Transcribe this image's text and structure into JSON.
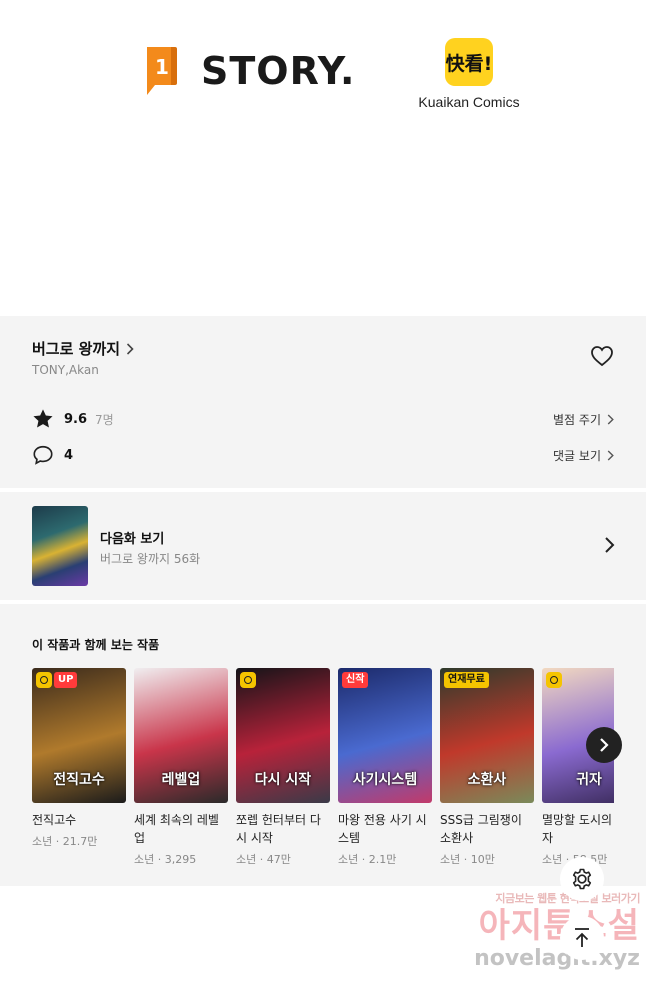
{
  "partners": {
    "story_logo_text": "STORY.",
    "story_mark_digit": "1",
    "kuaikan_badge_text": "快看!",
    "kuaikan_name": "Kuaikan Comics"
  },
  "series": {
    "title": "버그로 왕까지",
    "authors": "TONY,Akan",
    "rating": "9.6",
    "rating_count": "7명",
    "rate_link": "별점 주기",
    "comments": "4",
    "comments_link": "댓글 보기"
  },
  "next_episode": {
    "label": "다음화 보기",
    "subtitle": "버그로 왕까지 56화"
  },
  "recommendations": {
    "heading": "이 작품과 함께 보는 작품",
    "items": [
      {
        "title": "전직고수",
        "meta": "소년 · 21.7만",
        "badge": "UP",
        "badge_style": "red",
        "clock": true,
        "cover_text": "전직고수",
        "colors": [
          "#3a2a1c",
          "#b07a2c",
          "#1b1b1b"
        ]
      },
      {
        "title": "세계 최속의 레벨업",
        "meta": "소년 · 3,295",
        "badge": "",
        "badge_style": "",
        "clock": false,
        "cover_text": "레벨업",
        "colors": [
          "#f0eef0",
          "#c9354a",
          "#2a2a2a"
        ]
      },
      {
        "title": "쪼렙 헌터부터 다시 시작",
        "meta": "소년 · 47만",
        "badge": "",
        "badge_style": "",
        "clock": true,
        "cover_text": "다시 시작",
        "colors": [
          "#141418",
          "#b8223a",
          "#3a3a48"
        ]
      },
      {
        "title": "마왕 전용 사기 시스템",
        "meta": "소년 · 2.1만",
        "badge": "신작",
        "badge_style": "red",
        "clock": false,
        "cover_text": "사기시스템",
        "colors": [
          "#1c2a6a",
          "#4a6ad0",
          "#c23a6a"
        ]
      },
      {
        "title": "SSS급 그림쟁이 소환사",
        "meta": "소년 · 10만",
        "badge": "연재무료",
        "badge_style": "yellow",
        "clock": false,
        "cover_text": "소환사",
        "colors": [
          "#2e3a2c",
          "#c0392b",
          "#7a8a5a"
        ]
      },
      {
        "title": "멸망할 도시의 귀자",
        "meta": "소년 · 58.5만",
        "badge": "",
        "badge_style": "",
        "clock": true,
        "cover_text": "귀자",
        "colors": [
          "#f2d9c0",
          "#8a6ad0",
          "#3a2a5a"
        ]
      }
    ]
  },
  "watermark": {
    "line1": "지금보는 웹툰 현직소설 보러가기",
    "line2": "아지툰소설",
    "line3": "novelagit.xyz"
  },
  "icons": {
    "heart": "heart-icon",
    "star": "star-icon",
    "comment": "comment-bubble-icon",
    "settings": "gear-icon",
    "top": "arrow-up-icon",
    "next": "chevron-right-icon"
  }
}
